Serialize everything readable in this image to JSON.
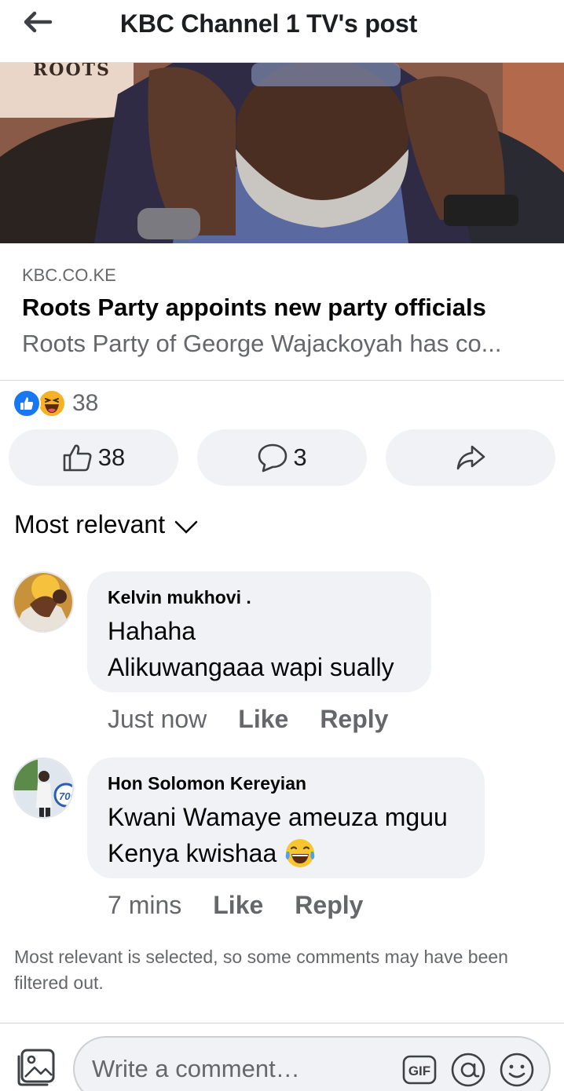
{
  "header": {
    "title": "KBC Channel 1 TV's post"
  },
  "article": {
    "image_text": "ROOTS",
    "domain": "KBC.CO.KE",
    "title": "Roots Party appoints new party officials",
    "description": "Roots Party of George Wajackoyah has co..."
  },
  "reactions": {
    "icons": [
      "like-reaction",
      "haha-reaction"
    ],
    "count": "38"
  },
  "actions": {
    "like_count": "38",
    "comment_count": "3"
  },
  "sort": {
    "label": "Most relevant"
  },
  "comments": [
    {
      "author": "Kelvin mukhovi .",
      "lines": [
        "Hahaha",
        "Alikuwangaaa wapi sually"
      ],
      "time": "Just now",
      "like": "Like",
      "reply": "Reply"
    },
    {
      "author": "Hon Solomon Kereyian",
      "lines": [
        "Kwani Wamaye ameuza mguu",
        "Kenya kwishaa"
      ],
      "time": "7 mins",
      "like": "Like",
      "reply": "Reply"
    }
  ],
  "filter_note": "Most relevant is selected, so some comments may have been filtered out.",
  "composer": {
    "placeholder": "Write a comment…",
    "gif_label": "GIF"
  },
  "colors": {
    "accent": "#1877f2",
    "muted": "#65676b",
    "bubble": "#f0f2f5"
  }
}
